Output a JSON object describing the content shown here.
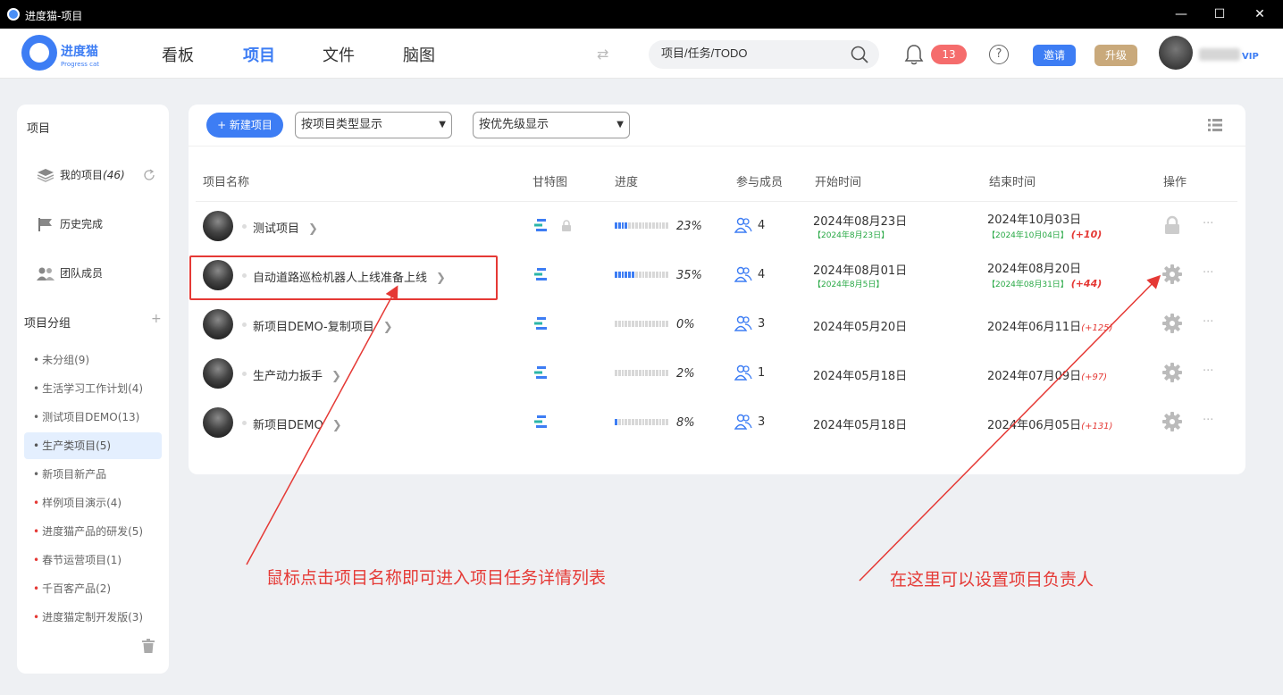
{
  "window": {
    "title": "进度猫-项目",
    "minimize": "—",
    "maximize": "☐",
    "close": "✕"
  },
  "header": {
    "logo_name": "进度猫",
    "logo_sub": "Progress cat",
    "nav": [
      "看板",
      "项目",
      "文件",
      "脑图"
    ],
    "active_nav": "项目",
    "search_placeholder": "项目/任务/TODO",
    "notification_count": "13",
    "help": "?",
    "invite": "邀请",
    "upgrade": "升级",
    "vip": "VIP"
  },
  "sidebar": {
    "title": "项目",
    "items": [
      {
        "label": "我的项目",
        "count": "(46)",
        "icon": "layers-icon"
      },
      {
        "label": "历史完成",
        "icon": "flag-icon"
      },
      {
        "label": "团队成员",
        "icon": "team-icon"
      }
    ],
    "group_title": "项目分组",
    "add": "+",
    "groups": [
      {
        "label": "未分组(9)",
        "selected": false,
        "red": false
      },
      {
        "label": "生活学习工作计划(4)",
        "selected": false,
        "red": false
      },
      {
        "label": "测试项目DEMO(13)",
        "selected": false,
        "red": false
      },
      {
        "label": "生产类项目(5)",
        "selected": true,
        "red": false
      },
      {
        "label": "新项目新产品",
        "selected": false,
        "red": false
      },
      {
        "label": "样例项目演示(4)",
        "selected": false,
        "red": true
      },
      {
        "label": "进度猫产品的研发(5)",
        "selected": false,
        "red": true
      },
      {
        "label": "春节运营项目(1)",
        "selected": false,
        "red": true
      },
      {
        "label": "千百客产品(2)",
        "selected": false,
        "red": true
      },
      {
        "label": "进度猫定制开发版(3)",
        "selected": false,
        "red": true
      }
    ]
  },
  "toolbar": {
    "new_project": "+ 新建项目",
    "filter_type": "按项目类型显示",
    "filter_priority": "按优先级显示"
  },
  "table": {
    "headers": [
      "项目名称",
      "甘特图",
      "进度",
      "参与成员",
      "开始时间",
      "结束时间",
      "操作"
    ],
    "rows": [
      {
        "name": "测试项目",
        "locked": true,
        "progress": 23,
        "progress_label": "23%",
        "members": "4",
        "start": "2024年08月23日",
        "start_actual": "【2024年8月23日】",
        "end": "2024年10月03日",
        "end_actual": "【2024年10月04日】",
        "delay": "(+10)",
        "op_icon": "lock-icon"
      },
      {
        "name": "自动道路巡检机器人上线准备上线",
        "locked": false,
        "progress": 35,
        "progress_label": "35%",
        "members": "4",
        "start": "2024年08月01日",
        "start_actual": "【2024年8月5日】",
        "end": "2024年08月20日",
        "end_actual": "【2024年08月31日】",
        "delay": "(+44)",
        "op_icon": "gear-icon"
      },
      {
        "name": "新项目DEMO-复制项目",
        "locked": false,
        "progress": 0,
        "progress_label": "0%",
        "members": "3",
        "start": "2024年05月20日",
        "start_actual": "",
        "end": "2024年06月11日",
        "end_actual": "",
        "delay": "(+125)",
        "op_icon": "gear-icon"
      },
      {
        "name": "生产动力扳手",
        "locked": false,
        "progress": 2,
        "progress_label": "2%",
        "members": "1",
        "start": "2024年05月18日",
        "start_actual": "",
        "end": "2024年07月09日",
        "end_actual": "",
        "delay": "(+97)",
        "op_icon": "gear-icon"
      },
      {
        "name": "新项目DEMO",
        "locked": false,
        "progress": 8,
        "progress_label": "8%",
        "members": "3",
        "start": "2024年05月18日",
        "start_actual": "",
        "end": "2024年06月05日",
        "end_actual": "",
        "delay": "(+131)",
        "op_icon": "gear-icon"
      }
    ]
  },
  "annotations": {
    "left": "鼠标点击项目名称即可进入项目任务详情列表",
    "right": "在这里可以设置项目负责人"
  },
  "colors": {
    "accent": "#3d7df4",
    "annotation": "#e53935",
    "success": "#27a844",
    "upgrade": "#c9a97b"
  }
}
